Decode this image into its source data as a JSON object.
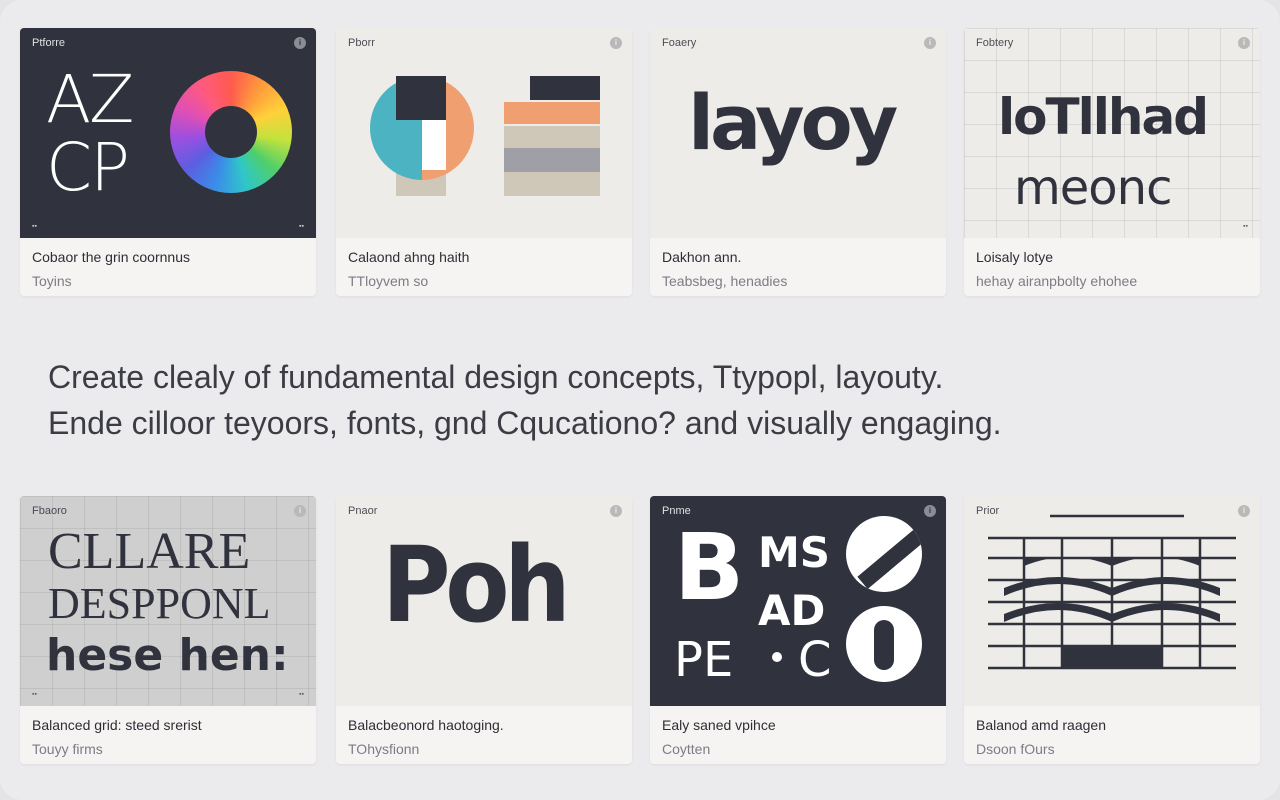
{
  "headline": {
    "line1": "Create clealy of fundamental design concepts, Ttypopl, layouty.",
    "line2": "Ende cilloor teyoors, fonts, gnd Cqucationo? and visually engaging."
  },
  "cards": [
    {
      "thumb_label": "Ptforre",
      "art_text": [
        "AZ",
        "CP"
      ],
      "caption": "Cobaor the grin coornnus",
      "subcaption": "Toyins"
    },
    {
      "thumb_label": "Pborr",
      "caption": "Calaond ahng haith",
      "subcaption": "TTloyvem so"
    },
    {
      "thumb_label": "Foaery",
      "art_text": [
        "layoy"
      ],
      "caption": "Dakhon ann.",
      "subcaption": "Teabsbeg, henadies"
    },
    {
      "thumb_label": "Fobtery",
      "art_text": [
        "loTllhad",
        "meonc"
      ],
      "caption": "Loisaly lotye",
      "subcaption": "hehay airanpbolty ehohee"
    },
    {
      "thumb_label": "Fbaoro",
      "art_text": [
        "CLLARE",
        "DESPPONL",
        "hese hen:"
      ],
      "caption": "Balanced grid: steed srerist",
      "subcaption": "Touyy firms"
    },
    {
      "thumb_label": "Pnaor",
      "art_text": [
        "Poh"
      ],
      "caption": "Balacbeonord haotoging.",
      "subcaption": "TOhysfionn"
    },
    {
      "thumb_label": "Pnme",
      "art_text": [
        "B",
        "MS",
        "AD",
        "PE",
        "C"
      ],
      "caption": "Ealy saned vpihce",
      "subcaption": "Coytten"
    },
    {
      "thumb_label": "Prior",
      "caption": "Balanod amd raagen",
      "subcaption": "Dsoon fOurs"
    }
  ],
  "icons": {
    "info": "info-icon"
  },
  "colors": {
    "dark": "#30323d",
    "light": "#eeece8",
    "teal": "#4bb3c1",
    "orange": "#f0a070",
    "gray_bar": "#9fa0a6",
    "beige_bar": "#cfc8b8"
  }
}
